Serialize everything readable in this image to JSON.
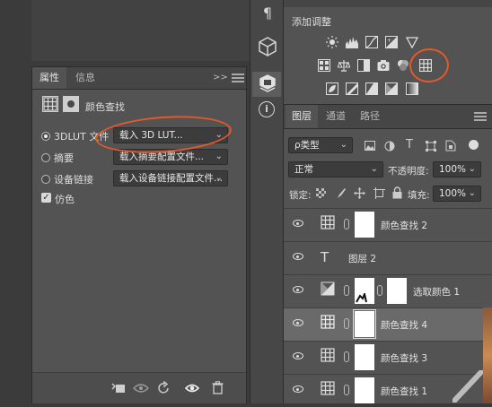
{
  "properties_panel": {
    "tabs": [
      "属性",
      "信息"
    ],
    "collapse_label": ">>",
    "title": "颜色查找",
    "options": [
      {
        "label": "3DLUT 文件",
        "value": "载入 3D LUT...",
        "selected": true
      },
      {
        "label": "摘要",
        "value": "载入摘要配置文件...",
        "selected": false
      },
      {
        "label": "设备链接",
        "value": "载入设备链接配置文件...",
        "selected": false
      }
    ],
    "dither_label": "仿色",
    "dither_checked": true,
    "check_glyph": "✓",
    "chevron": "⌄",
    "bottom_icons": [
      "clip-to-layer-icon",
      "view-previous-icon",
      "reset-icon",
      "visibility-icon",
      "delete-icon"
    ]
  },
  "tools_column": {
    "icons": [
      "paragraph-icon",
      "3d-cube-icon",
      "3d-layers-icon",
      "info-icon"
    ],
    "paragraph_glyph": "¶",
    "info_glyph": "i"
  },
  "adjustments_panel": {
    "title": "添加调整"
  },
  "layers_panel": {
    "tabs": [
      "图层",
      "通道",
      "路径"
    ],
    "filter_label": "ρ类型",
    "blend_mode": "正常",
    "opacity_label": "不透明度:",
    "opacity_value": "100%",
    "lock_label": "锁定:",
    "fill_label": "填充:",
    "fill_value": "100%",
    "type_glyph": "T",
    "layers": [
      {
        "name": "颜色查找 2",
        "type": "lookup",
        "selected": false
      },
      {
        "name": "图层 2",
        "type": "text",
        "selected": false
      },
      {
        "name": "选取颜色 1",
        "type": "selective-color",
        "selected": false
      },
      {
        "name": "颜色查找 4",
        "type": "lookup",
        "selected": true
      },
      {
        "name": "颜色查找 3",
        "type": "lookup",
        "selected": false
      },
      {
        "name": "颜色查找 1",
        "type": "lookup",
        "selected": false
      }
    ]
  },
  "colors": {
    "annotation": "#e2592b",
    "panel": "#535353",
    "selected_row": "#6a6a6a"
  }
}
